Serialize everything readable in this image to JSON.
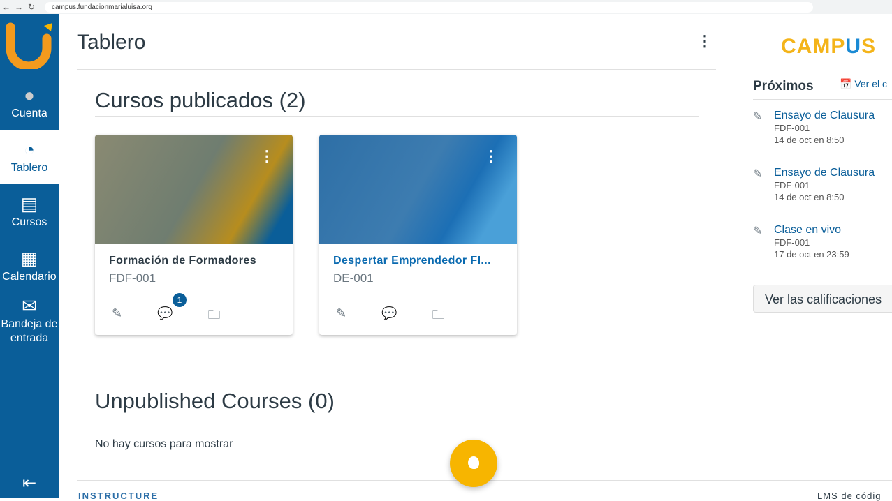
{
  "browser": {
    "url": "campus.fundacionmarialuisa.org"
  },
  "sidebar": {
    "items": [
      {
        "label": "Cuenta",
        "icon": "user-icon"
      },
      {
        "label": "Tablero",
        "icon": "dashboard-icon"
      },
      {
        "label": "Cursos",
        "icon": "courses-icon"
      },
      {
        "label": "Calendario",
        "icon": "calendar-icon"
      },
      {
        "label": "Bandeja de entrada",
        "icon": "inbox-icon"
      }
    ],
    "brand_color": "#0a5e99"
  },
  "header": {
    "title": "Tablero"
  },
  "published": {
    "heading": "Cursos publicados (2)",
    "courses": [
      {
        "name": "Formación de Formadores",
        "code": "FDF-001",
        "badge": "1",
        "color": "#b78d1e"
      },
      {
        "name": "Despertar Emprendedor FI...",
        "code": "DE-001",
        "color": "#1c6fb5"
      }
    ]
  },
  "unpublished": {
    "heading": "Unpublished Courses (0)",
    "empty": "No hay cursos para mostrar"
  },
  "footer": {
    "brand": "INSTRUCTURE",
    "right": "LMS de códig"
  },
  "right": {
    "logo": "CAMPUS",
    "heading": "Próximos",
    "calendar_link": "Ver el c",
    "todos": [
      {
        "title": "Ensayo de Clausura",
        "course": "FDF-001",
        "date": "14 de oct en 8:50"
      },
      {
        "title": "Ensayo de Clausura",
        "course": "FDF-001",
        "date": "14 de oct en 8:50"
      },
      {
        "title": "Clase en vivo",
        "course": "FDF-001",
        "date": "17 de oct en 23:59"
      }
    ],
    "grades_button": "Ver las calificaciones"
  }
}
